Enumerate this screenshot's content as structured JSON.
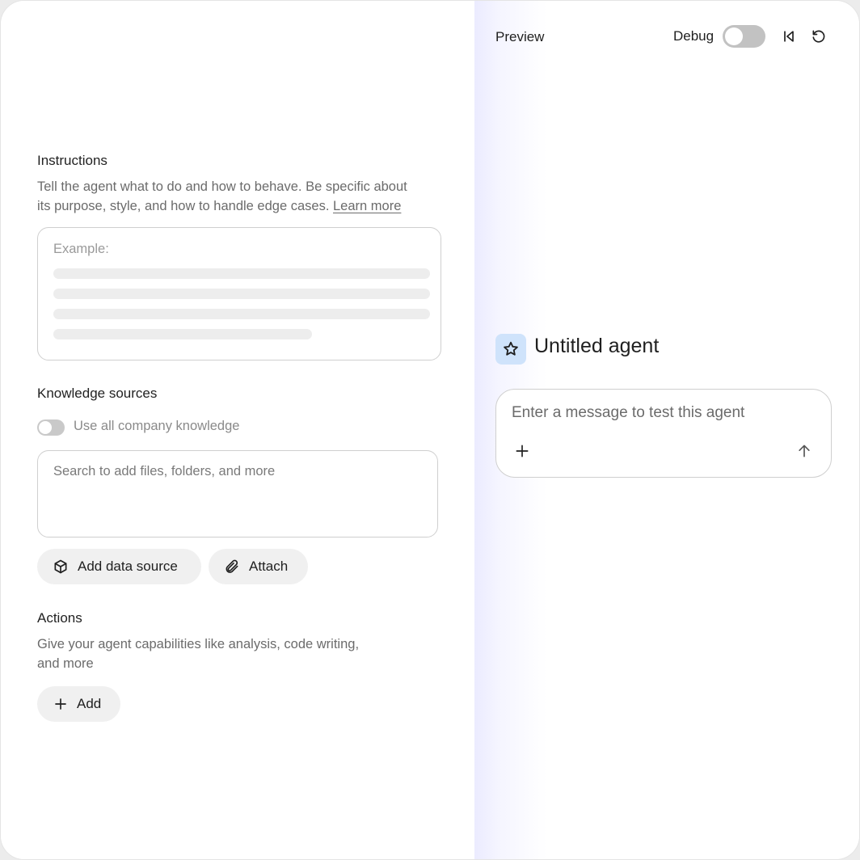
{
  "instructions": {
    "title": "Instructions",
    "description_line1": "Tell the agent what to do and how to behave. Be specific about",
    "description_line2": "its purpose, style, and how to handle edge cases.",
    "learn_more": "Learn more",
    "placeholder": "Example:"
  },
  "knowledge": {
    "title": "Knowledge sources",
    "toggle_label": "Use all company knowledge",
    "toggle_on": false,
    "search_placeholder": "Search to add files, folders, and more",
    "add_data_source": "Add data source",
    "attach": "Attach"
  },
  "actions": {
    "title": "Actions",
    "description_line1": "Give your agent capabilities like analysis, code writing,",
    "description_line2": "and more",
    "add": "Add"
  },
  "preview": {
    "title": "Preview",
    "debug_label": "Debug",
    "debug_on": false,
    "agent_name": "Untitled agent",
    "chat_placeholder": "Enter a message to test this agent",
    "icons": [
      "skip-back-icon",
      "refresh-icon",
      "star-icon",
      "plus-icon",
      "arrow-up-icon"
    ]
  },
  "colors": {
    "avatar_bg": "#cfe3fb",
    "pill_bg": "#f0f0f0",
    "panel_gradient": "#ebebff"
  }
}
